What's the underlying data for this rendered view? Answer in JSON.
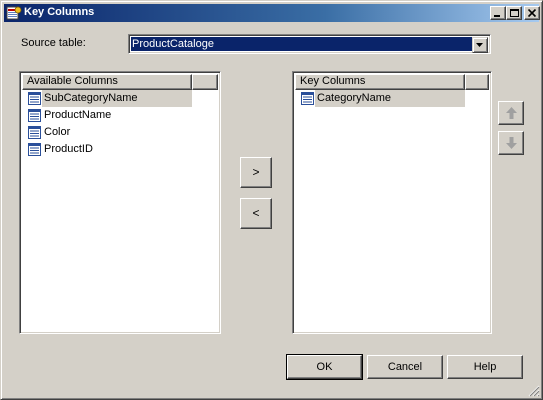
{
  "window": {
    "title": "Key Columns"
  },
  "source": {
    "label": "Source table:",
    "selected": "ProductCataloge"
  },
  "available": {
    "header": "Available Columns",
    "items": [
      {
        "label": "SubCategoryName",
        "selected": true
      },
      {
        "label": "ProductName",
        "selected": false
      },
      {
        "label": "Color",
        "selected": false
      },
      {
        "label": "ProductID",
        "selected": false
      }
    ]
  },
  "key": {
    "header": "Key Columns",
    "items": [
      {
        "label": "CategoryName",
        "selected": true
      }
    ]
  },
  "buttons": {
    "add": ">",
    "remove": "<",
    "move_up_icon": "up-arrow-icon",
    "move_down_icon": "down-arrow-icon",
    "ok": "OK",
    "cancel": "Cancel",
    "help": "Help"
  },
  "colors": {
    "title_bar": "#0a246a",
    "face": "#d4d0c8",
    "selection": "#0a246a"
  }
}
